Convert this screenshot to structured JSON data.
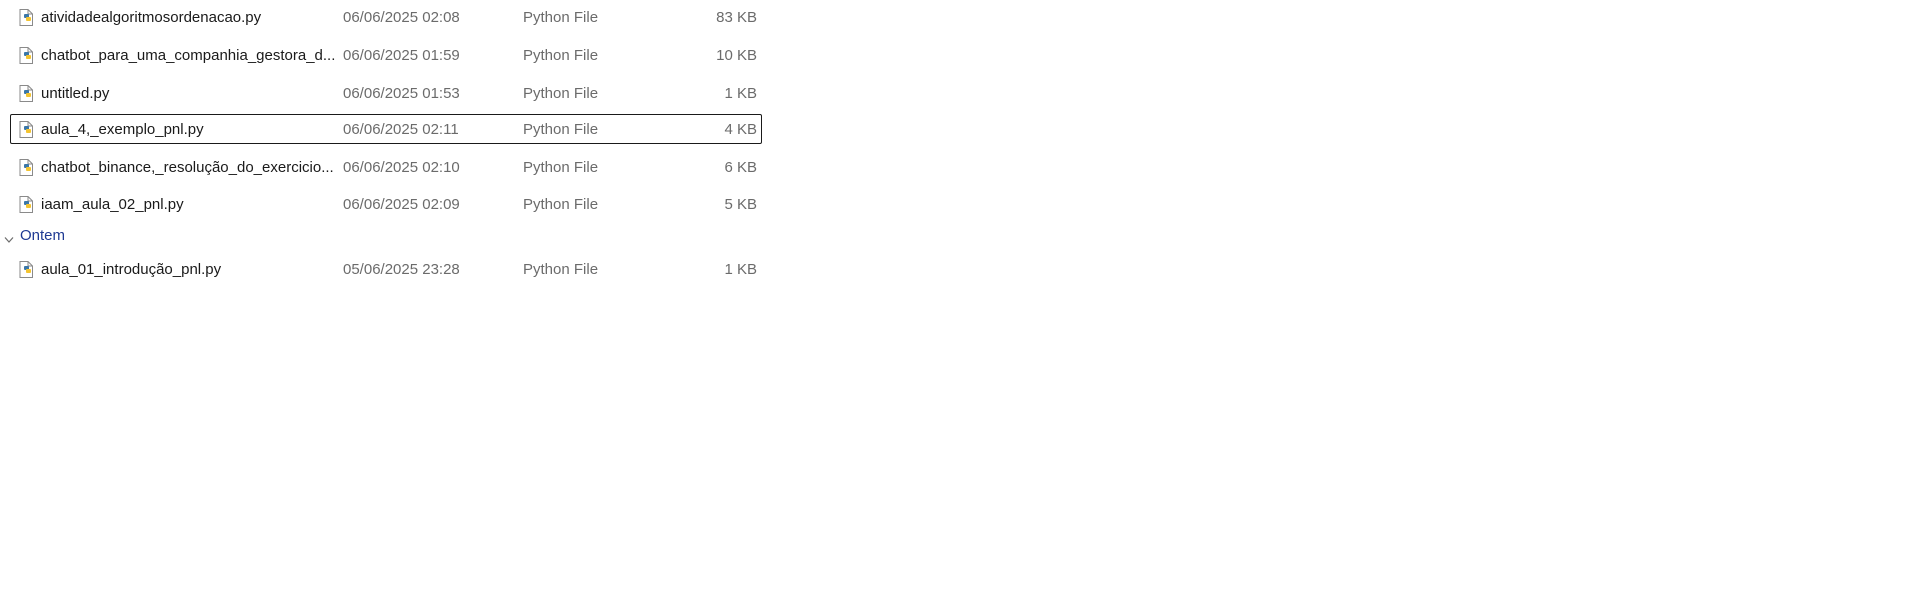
{
  "files_today": [
    {
      "name": "atividadealgoritmosordenacao.py",
      "modified": "06/06/2025 02:08",
      "type": "Python File",
      "size": "83 KB"
    },
    {
      "name": "chatbot_para_uma_companhia_gestora_d...",
      "modified": "06/06/2025 01:59",
      "type": "Python File",
      "size": "10 KB"
    },
    {
      "name": "untitled.py",
      "modified": "06/06/2025 01:53",
      "type": "Python File",
      "size": "1 KB"
    },
    {
      "name": "aula_4,_exemplo_pnl.py",
      "modified": "06/06/2025 02:11",
      "type": "Python File",
      "size": "4 KB"
    },
    {
      "name": "chatbot_binance,_resolução_do_exercicio...",
      "modified": "06/06/2025 02:10",
      "type": "Python File",
      "size": "6 KB"
    },
    {
      "name": "iaam_aula_02_pnl.py",
      "modified": "06/06/2025 02:09",
      "type": "Python File",
      "size": "5 KB"
    }
  ],
  "group_yesterday": {
    "label": "Ontem",
    "files": [
      {
        "name": "aula_01_introdução_pnl.py",
        "modified": "05/06/2025 23:28",
        "type": "Python File",
        "size": "1 KB"
      }
    ]
  },
  "colors": {
    "group_label": "#1f3a93",
    "secondary_text": "#6b6b6b",
    "focus_border": "#1a1a1a",
    "python_blue": "#3b77a8",
    "python_yellow": "#f4c430"
  }
}
